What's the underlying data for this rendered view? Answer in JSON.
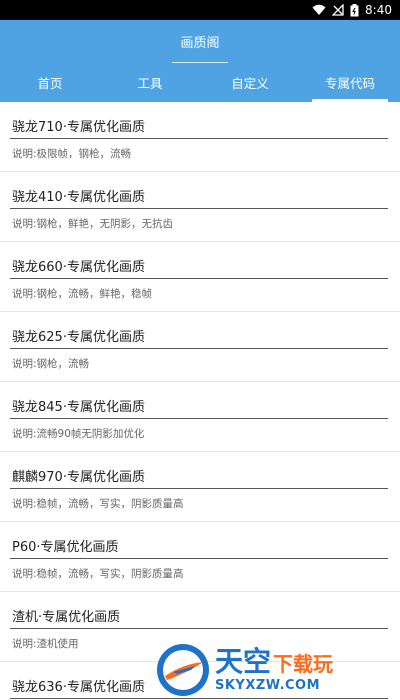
{
  "status_bar": {
    "time": "8:40",
    "icons": [
      "wifi-icon",
      "signal-icon",
      "battery-icon"
    ]
  },
  "app_bar": {
    "title": "画质阁"
  },
  "tabs": [
    {
      "label": "首页",
      "active": false
    },
    {
      "label": "工具",
      "active": false
    },
    {
      "label": "自定义",
      "active": false
    },
    {
      "label": "专属代码",
      "active": true
    }
  ],
  "items": [
    {
      "title": "骁龙710·专属优化画质",
      "desc": "说明:极限帧，钢枪，流畅"
    },
    {
      "title": "骁龙410·专属优化画质",
      "desc": "说明:钢枪，鲜艳，无阴影，无抗齿"
    },
    {
      "title": "骁龙660·专属优化画质",
      "desc": "说明:钢枪，流畅，鲜艳，稳帧"
    },
    {
      "title": "骁龙625·专属优化画质",
      "desc": "说明:钢枪，流畅"
    },
    {
      "title": "骁龙845·专属优化画质",
      "desc": "说明:流畅90帧无阴影加优化"
    },
    {
      "title": "麒麟970·专属优化画质",
      "desc": "说明:稳帧，流畅，写实，阴影质量高"
    },
    {
      "title": "P60·专属优化画质",
      "desc": "说明:稳帧，流畅，写实，阴影质量高"
    },
    {
      "title": "渣机·专属优化画质",
      "desc": "说明:渣机使用"
    },
    {
      "title": "骁龙636·专属优化画质",
      "desc": ""
    }
  ],
  "watermark": {
    "main_a": "天空",
    "main_b": "下载玩",
    "sub": "SKYXZW.COM"
  },
  "colors": {
    "primary": "#4fa3e3",
    "status_bar": "#000000",
    "watermark_blue": "#1e73c8",
    "watermark_orange": "#ff6a1a"
  }
}
